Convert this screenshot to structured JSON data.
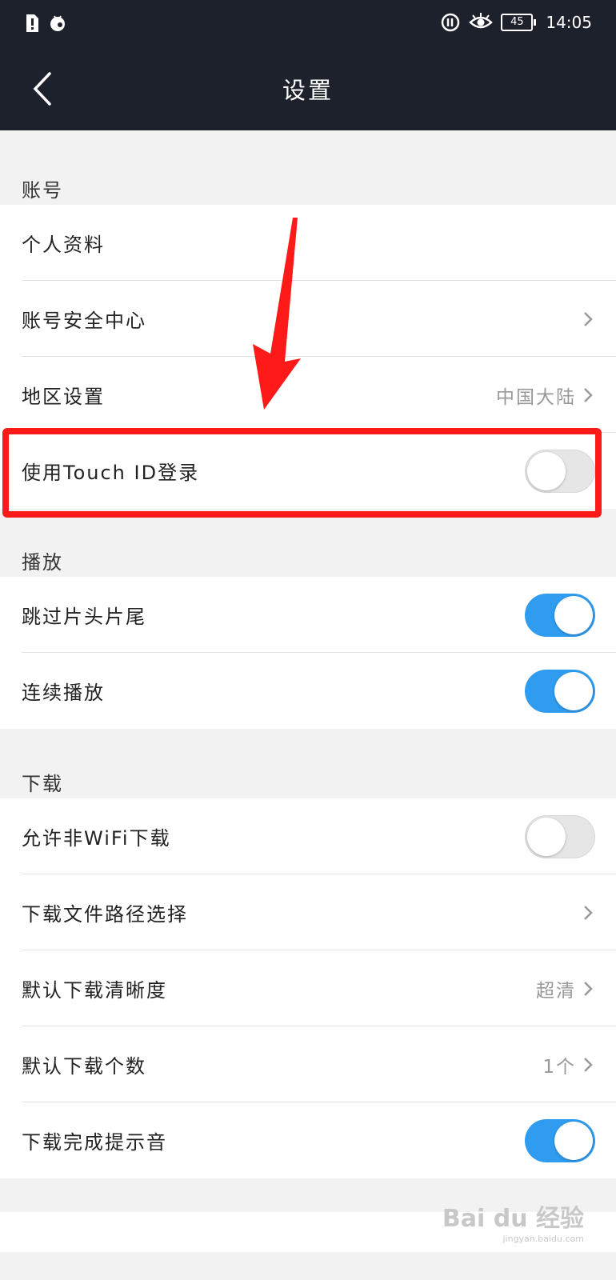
{
  "status_bar": {
    "time": "14:05",
    "battery": "45"
  },
  "nav": {
    "title": "设置"
  },
  "sections": {
    "account": {
      "label": "账号",
      "items": {
        "profile": {
          "label": "个人资料"
        },
        "security": {
          "label": "账号安全中心"
        },
        "region": {
          "label": "地区设置",
          "value": "中国大陆"
        },
        "touch_id": {
          "label": "使用Touch ID登录",
          "on": false
        }
      }
    },
    "playback": {
      "label": "播放",
      "items": {
        "skip": {
          "label": "跳过片头片尾",
          "on": true
        },
        "continuous": {
          "label": "连续播放",
          "on": true
        }
      }
    },
    "download": {
      "label": "下载",
      "items": {
        "non_wifi": {
          "label": "允许非WiFi下载",
          "on": false
        },
        "path": {
          "label": "下载文件路径选择"
        },
        "quality": {
          "label": "默认下载清晰度",
          "value": "超清"
        },
        "count": {
          "label": "默认下载个数",
          "value": "1个"
        },
        "sound": {
          "label": "下载完成提示音",
          "on": true
        }
      }
    }
  },
  "watermark": {
    "brand": "Bai du 经验",
    "url": "jingyan.baidu.com"
  },
  "colors": {
    "header": "#1d212b",
    "toggle_on": "#2f9cf0",
    "highlight": "#ff1a1a"
  },
  "icons": [
    "back-arrow-icon",
    "chevron-right-icon",
    "sim-alert-icon",
    "notification-icon",
    "data-icon",
    "eye-icon",
    "battery-icon"
  ]
}
